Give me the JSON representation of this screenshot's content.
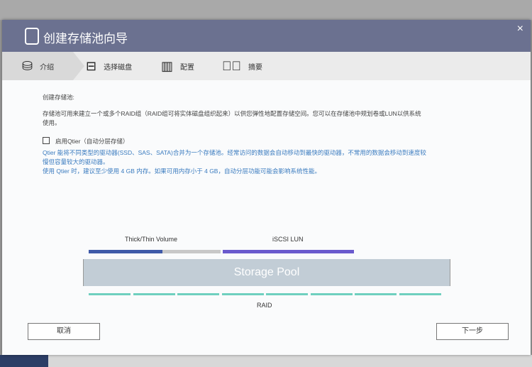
{
  "dialog": {
    "title": "创建存储池向导",
    "close": "×"
  },
  "steps": [
    {
      "label": "介绍"
    },
    {
      "label": "选择磁盘"
    },
    {
      "label": "配置"
    },
    {
      "label": "摘要"
    }
  ],
  "body": {
    "heading": "创建存储池:",
    "desc1": "存储池可用来建立一个或多个RAID组（RAID组可将实体磁盘组织起来）以供您弹性地配置存储空间。您可以在存储池中规划卷或LUN以供系统",
    "desc2": "使用。",
    "qtier_label": "启用Qtier（自动分层存储）",
    "qtier_checked": false,
    "info1": "Qtier 能将不同类型的驱动器(SSD、SAS、SATA)合并为一个存储池。经常访问的数据会自动移动到最快的驱动器，不常用的数据会移动到速度较",
    "info2": "慢但容量较大的驱动器。",
    "info3": "使用 Qtier 时，建议至少使用 4 GB 内存。如果可用内存小于 4 GB，自动分层功能可能会影响系统性能。"
  },
  "diagram": {
    "volume": "Thick/Thin Volume",
    "lun": "iSCSI LUN",
    "pool": "Storage Pool",
    "raid": "RAID",
    "colors": {
      "volume": "#3f5aa8",
      "free": "#c8c8c8",
      "lun": "#6a5acd",
      "raid": "#6fd0bf"
    }
  },
  "buttons": {
    "cancel": "取消",
    "next": "下一步"
  }
}
